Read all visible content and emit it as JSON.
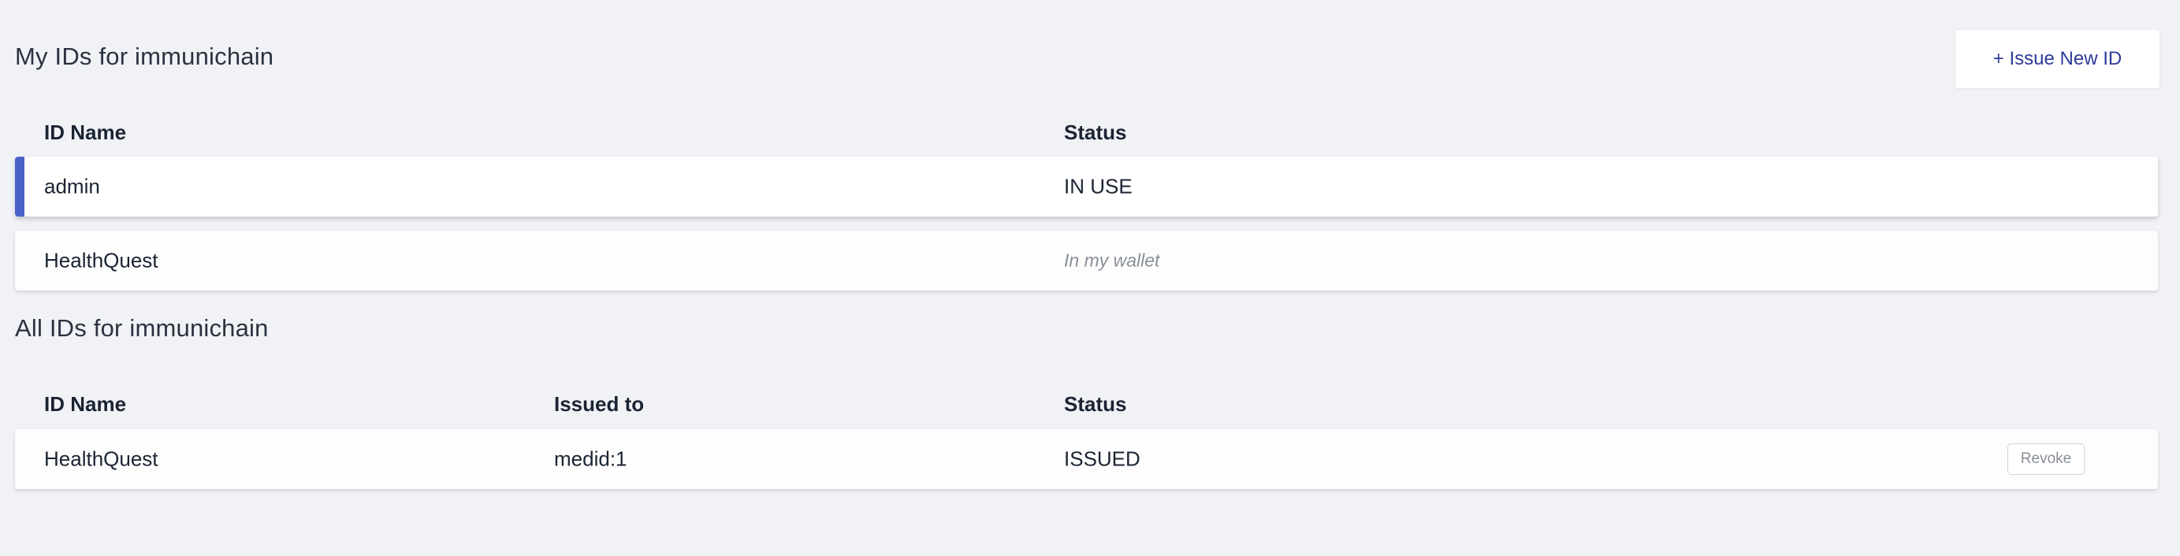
{
  "my_ids": {
    "title": "My IDs for immunichain",
    "issue_button_label": "+ Issue New ID",
    "columns": {
      "name": "ID Name",
      "status": "Status"
    },
    "rows": [
      {
        "name": "admin",
        "status": "IN USE"
      },
      {
        "name": "HealthQuest",
        "status": "In my wallet"
      }
    ]
  },
  "all_ids": {
    "title": "All IDs for immunichain",
    "columns": {
      "name": "ID Name",
      "issued_to": "Issued to",
      "status": "Status"
    },
    "rows": [
      {
        "name": "HealthQuest",
        "issued_to": "medid:1",
        "status": "ISSUED",
        "action_label": "Revoke"
      }
    ]
  },
  "colors": {
    "accent": "#4a63c9",
    "link": "#2c3a99",
    "background": "#f1f2f6"
  }
}
